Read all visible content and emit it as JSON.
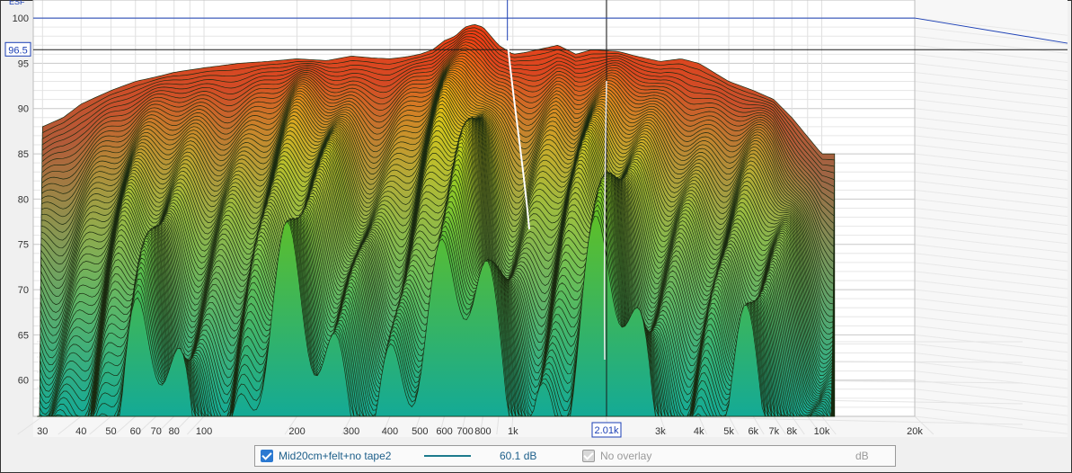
{
  "chart_data": {
    "type": "area",
    "subtype": "waterfall-3d",
    "x_ticks": [
      "30",
      "40",
      "50",
      "60",
      "70",
      "80",
      "100",
      "200",
      "300",
      "400",
      "500",
      "600",
      "700",
      "800",
      "1k",
      "2k",
      "3k",
      "4k",
      "5k",
      "6k",
      "7k",
      "8k",
      "10k",
      "20k"
    ],
    "y_ticks": [
      "60",
      "65",
      "70",
      "75",
      "80",
      "85",
      "90",
      "95",
      "100"
    ],
    "ylim": [
      56,
      101
    ],
    "x_scale": "log",
    "xlim": [
      28,
      20000
    ],
    "cursor": {
      "freq_label": "2.01k",
      "level_label": "96.5"
    },
    "corner_label": "ESF",
    "first_slice": {
      "x": [
        28,
        30,
        35,
        40,
        50,
        60,
        70,
        80,
        100,
        130,
        160,
        200,
        250,
        300,
        350,
        400,
        450,
        500,
        550,
        600,
        650,
        700,
        750,
        800,
        900,
        1000,
        1100,
        1200,
        1400,
        1600,
        1800,
        2000,
        2200,
        2500,
        3000,
        3500,
        4000,
        5000,
        6000,
        7000,
        8000,
        10000
      ],
      "y": [
        87.5,
        88,
        89,
        90.5,
        92,
        93,
        93.5,
        94,
        94.5,
        95,
        95.2,
        95.5,
        95.3,
        95.8,
        95.6,
        95.5,
        95.7,
        96,
        96.5,
        97.5,
        98,
        99,
        99.3,
        99,
        97,
        96,
        96.2,
        96.5,
        97,
        96,
        96.5,
        96.4,
        96.3,
        95.8,
        95.2,
        95.5,
        95,
        93,
        92,
        91,
        89,
        85
      ]
    }
  },
  "legend": {
    "series_name": "Mid20cm+felt+no tape2",
    "series_value": "60.1 dB",
    "overlay_label": "No overlay",
    "overlay_unit": "dB",
    "series_color": "#1c7a8c"
  }
}
